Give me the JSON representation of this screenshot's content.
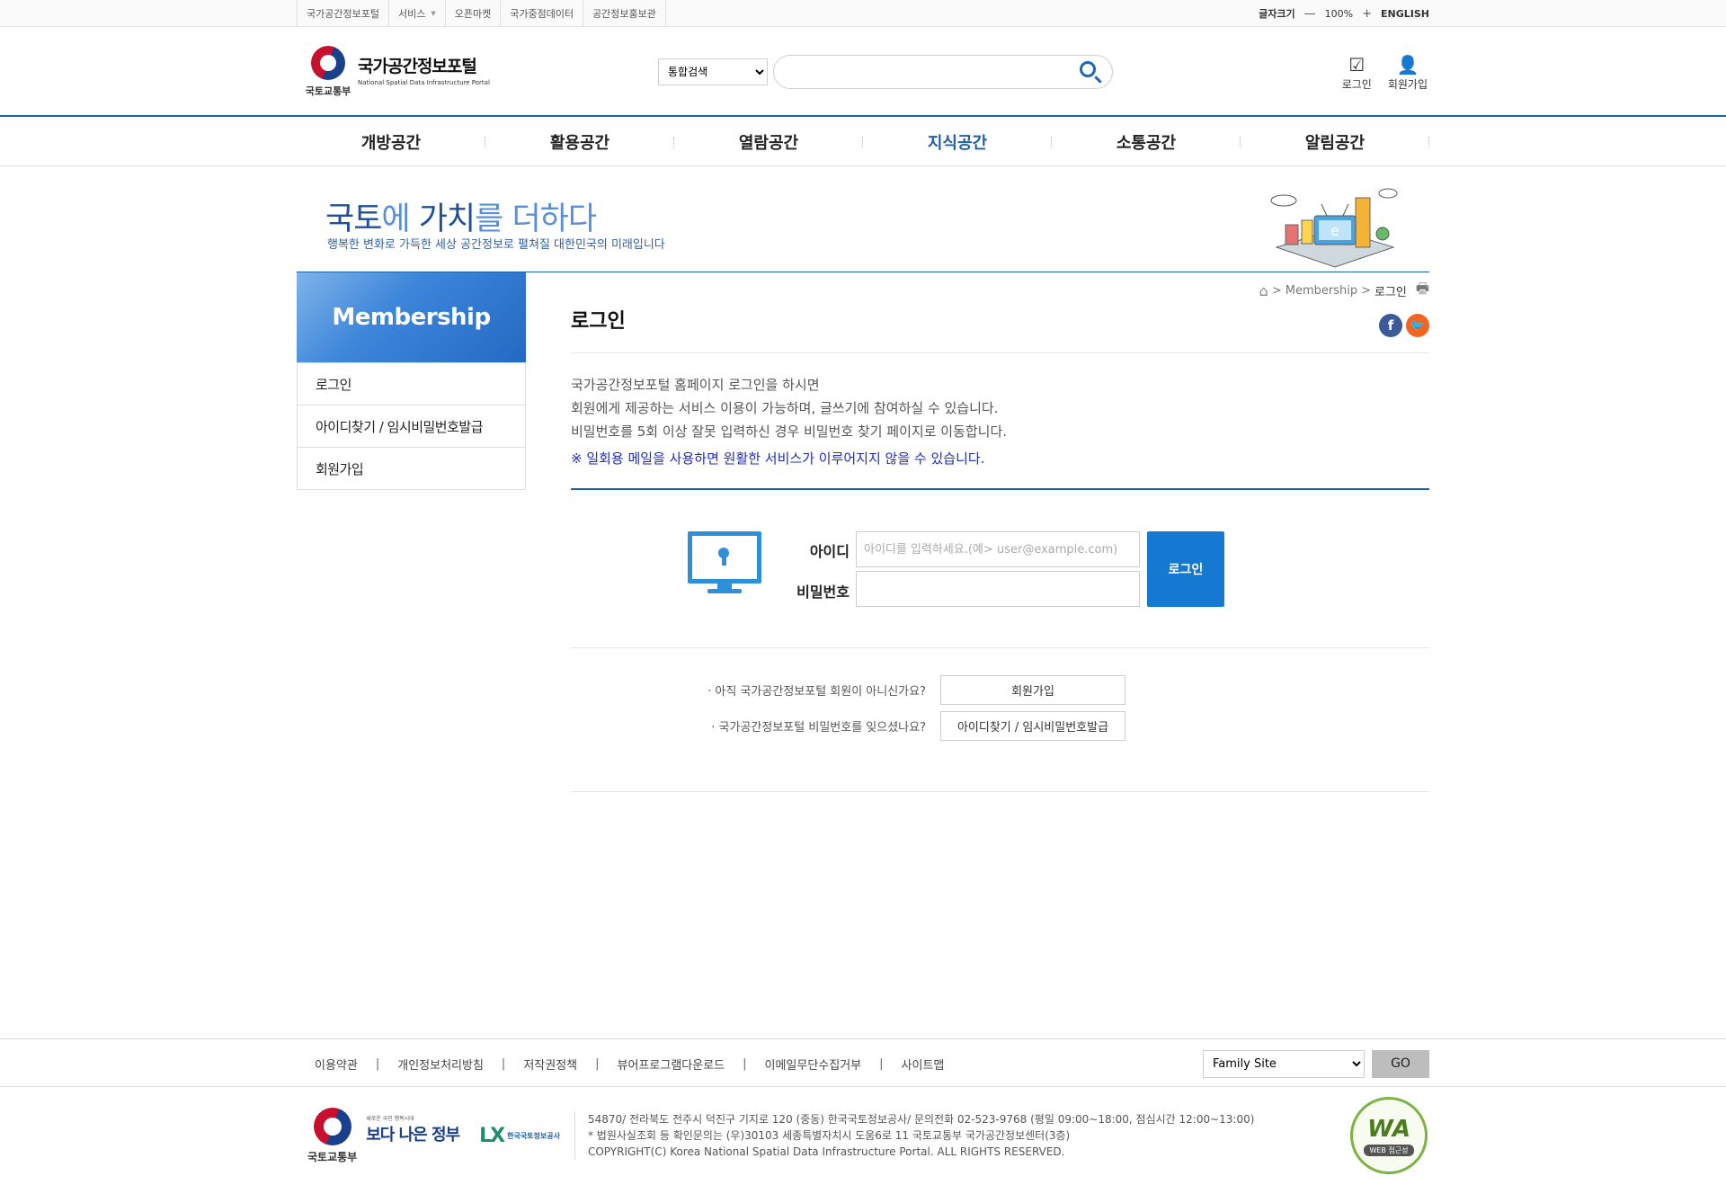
{
  "util": {
    "links": [
      "국가공간정보포털",
      "서비스",
      "오픈마켓",
      "국가중점데이터",
      "공간정보홍보관"
    ],
    "font_size_label": "글자크기",
    "minus": "—",
    "zoom": "100%",
    "plus": "+",
    "english": "ENGLISH"
  },
  "header": {
    "ministry": "국토교통부",
    "site_title": "국가공간정보포털",
    "site_subtitle": "National Spatial Data Infrastructure Portal",
    "search_scope": "통합검색",
    "search_value": "",
    "login_label": "로그인",
    "join_label": "회원가입"
  },
  "gnb": {
    "items": [
      "개방공간",
      "활용공간",
      "열람공간",
      "지식공간",
      "소통공간",
      "알림공간"
    ],
    "active": "지식공간"
  },
  "visual": {
    "slogan_a": "국토",
    "slogan_b": "에 ",
    "slogan_c": "가치",
    "slogan_d": "를 더하다",
    "subtitle": "행복한 변화로 가득한 세상 공간정보로 펼쳐질 대한민국의 미래입니다"
  },
  "lnb": {
    "title": "Membership",
    "items": [
      "로그인",
      "아이디찾기 / 임시비밀번호발급",
      "회원가입"
    ]
  },
  "breadcrumb": {
    "sep": ">",
    "section": "Membership",
    "current": "로그인"
  },
  "page": {
    "title": "로그인",
    "intro": [
      "국가공간정보포털 홈페이지 로그인을 하시면",
      "회원에게 제공하는 서비스 이용이 가능하며, 글쓰기에 참여하실 수 있습니다.",
      "비밀번호를 5회 이상 잘못 입력하신 경우 비밀번호 찾기 페이지로 이동합니다."
    ],
    "warning": "※ 일회용 메일을 사용하면 원활한 서비스가 이루어지지 않을 수 있습니다."
  },
  "login_form": {
    "id_label": "아이디",
    "id_placeholder": "아이디를 입력하세요.(예> user@example.com)",
    "id_value": "",
    "pw_label": "비밀번호",
    "pw_value": "",
    "submit": "로그인"
  },
  "help": {
    "q1": "· 아직 국가공간정보포털 회원이 아니신가요?",
    "b1": "회원가입",
    "q2": "· 국가공간정보포털 비밀번호를 잊으셨나요?",
    "b2": "아이디찾기 / 임시비밀번호발급"
  },
  "footer": {
    "links": [
      "이용약관",
      "개인정보처리방침",
      "저작권정책",
      "뷰어프로그램다운로드",
      "이메일무단수집거부",
      "사이트맵"
    ],
    "sep": "|",
    "family_site": "Family Site",
    "go": "GO",
    "ministry": "국토교통부",
    "gov_small": "새로운 국민 행복시대",
    "gov_big": "보다 나은 정부",
    "lx_short": "LX",
    "lx_name": "한국국토정보공사",
    "addr": [
      "54870/ 전라북도 전주시 덕진구 기지로 120 (중동) 한국국토정보공사/ 문의전화 02-523-9768 (평일 09:00~18:00, 점심시간 12:00~13:00)",
      "* 법원사실조회 등 확인문의는 (우)30103 세종특별자치시 도움6로 11 국토교통부 국가공간정보센터(3층)",
      "COPYRIGHT(C) Korea National Spatial Data Infrastructure Portal. ALL RIGHTS RESERVED."
    ],
    "wa_mark": "WA",
    "wa_label": "WEB 접근성"
  },
  "colors": {
    "brand": "#1f5fa8",
    "button": "#1579d1",
    "warning": "#1e2acc"
  }
}
